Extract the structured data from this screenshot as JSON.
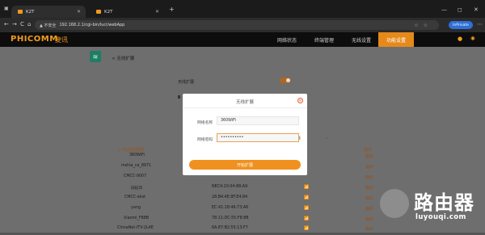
{
  "browser": {
    "tabs": [
      {
        "label": "K2T"
      },
      {
        "label": "K2T"
      }
    ],
    "new_tab": "+",
    "controls": {
      "minimize": "—",
      "maximize": "◻",
      "close": "✕"
    },
    "nav": {
      "back": "←",
      "forward": "→",
      "reload": "C",
      "home": "⌂"
    },
    "security_label": "▲ 不安全",
    "url": "192.168.2.1/cgi-bin/luci/webApp",
    "profile_label": "InPrivate",
    "more": "⋯"
  },
  "router": {
    "brand": "PHICOMM",
    "brand_cn": "斐讯",
    "menu": [
      "网络状态",
      "终端管理",
      "无线设置",
      "功能设置"
    ],
    "active_menu": 3
  },
  "page": {
    "back_label": "< 无线扩展",
    "toggle_label": "无线扩展",
    "toggle_on": true,
    "network_header": "2.4G无线网络",
    "action_header": "操作"
  },
  "networks": [
    {
      "name": "360WiFi",
      "mac": "",
      "signal": "",
      "action": "操作"
    },
    {
      "name": "mshia_ca_8971",
      "mac": "",
      "signal": "",
      "action": "操作"
    },
    {
      "name": "CMCC-9007",
      "mac": "",
      "signal": "",
      "action": "操作"
    },
    {
      "name": "旧纪华",
      "mac": "NEC4:20:04:88:A9",
      "signal": "📶",
      "action": "操作"
    },
    {
      "name": "CMCC-ekst",
      "mac": "28:B4:4E:8F:E4:84",
      "signal": "📶",
      "action": "操作"
    },
    {
      "name": "yang",
      "mac": "EC:41:18:46:73:A6",
      "signal": "📶",
      "action": "操作"
    },
    {
      "name": "Xiaomi_F88B",
      "mac": "78:11:DC:55:F8:8B",
      "signal": "📶",
      "action": "操作"
    },
    {
      "name": "ChinaNet-ITV-2L4E",
      "mac": "6A:87:B2:55:13:F7",
      "signal": "📶",
      "action": "操作"
    }
  ],
  "modal": {
    "title": "无线扩展",
    "close": "✕",
    "ssid_label": "网络名称",
    "ssid_value": "360WiFi",
    "password_label": "网络密码",
    "password_value": "••••••••••",
    "submit_label": "开始扩展"
  },
  "watermark": {
    "big": "路由器",
    "small": "luyouqi.com"
  },
  "colors": {
    "accent": "#f0911f",
    "brand": "#f39c1d",
    "modal_bg": "#ffffff",
    "overlay": "#6e6e6e"
  }
}
